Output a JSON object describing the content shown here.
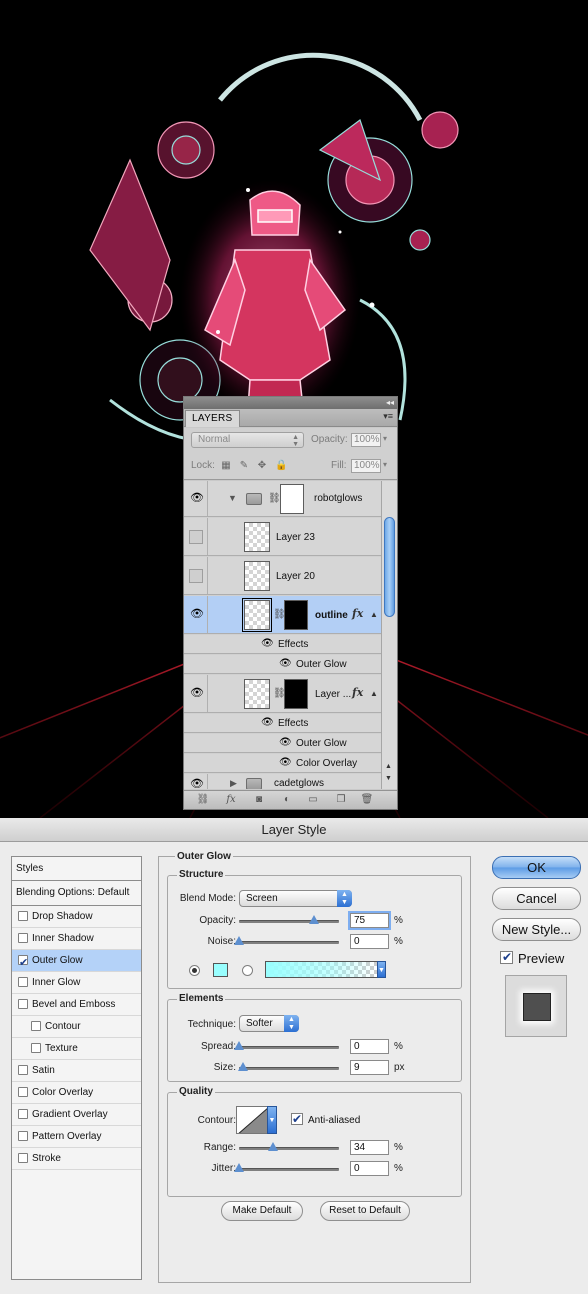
{
  "layers_panel": {
    "tab": "LAYERS",
    "blend_mode": "Normal",
    "opacity_label": "Opacity:",
    "opacity_value": "100%",
    "lock_label": "Lock:",
    "fill_label": "Fill:",
    "fill_value": "100%",
    "layers": [
      {
        "name": "robotglows",
        "type": "group-expanded",
        "visible": true
      },
      {
        "name": "Layer 23",
        "type": "layer",
        "visible": false
      },
      {
        "name": "Layer 20",
        "type": "layer",
        "visible": false
      },
      {
        "name": "outline",
        "type": "layer-with-mask",
        "visible": true,
        "selected": true,
        "effects_label": "Effects",
        "effects": [
          "Outer Glow"
        ]
      },
      {
        "name": "Layer ...",
        "type": "layer-with-mask",
        "visible": true,
        "effects_label": "Effects",
        "effects": [
          "Outer Glow",
          "Color Overlay"
        ]
      },
      {
        "name": "cadetglows",
        "type": "group-collapsed",
        "visible": true
      }
    ],
    "fx_label": "fx",
    "footer_icons": [
      "link-icon",
      "fx-icon",
      "add-mask-icon",
      "adjustment-icon",
      "new-group-icon",
      "new-layer-icon",
      "trash-icon"
    ]
  },
  "dialog": {
    "title": "Layer Style",
    "styles_header": "Styles",
    "blending_options": "Blending Options: Default",
    "styles": [
      {
        "label": "Drop Shadow",
        "checked": false,
        "indent": false
      },
      {
        "label": "Inner Shadow",
        "checked": false,
        "indent": false
      },
      {
        "label": "Outer Glow",
        "checked": true,
        "indent": false,
        "selected": true
      },
      {
        "label": "Inner Glow",
        "checked": false,
        "indent": false
      },
      {
        "label": "Bevel and Emboss",
        "checked": false,
        "indent": false
      },
      {
        "label": "Contour",
        "checked": false,
        "indent": true
      },
      {
        "label": "Texture",
        "checked": false,
        "indent": true
      },
      {
        "label": "Satin",
        "checked": false,
        "indent": false
      },
      {
        "label": "Color Overlay",
        "checked": false,
        "indent": false
      },
      {
        "label": "Gradient Overlay",
        "checked": false,
        "indent": false
      },
      {
        "label": "Pattern Overlay",
        "checked": false,
        "indent": false
      },
      {
        "label": "Stroke",
        "checked": false,
        "indent": false
      }
    ],
    "outer_glow": {
      "title": "Outer Glow",
      "structure": {
        "title": "Structure",
        "blend_mode_label": "Blend Mode:",
        "blend_mode": "Screen",
        "opacity_label": "Opacity:",
        "opacity": "75",
        "opacity_fraction": 0.75,
        "noise_label": "Noise:",
        "noise": "0",
        "noise_fraction": 0,
        "percent": "%",
        "glow_color": "#99ffff"
      },
      "elements": {
        "title": "Elements",
        "technique_label": "Technique:",
        "technique": "Softer",
        "spread_label": "Spread:",
        "spread": "0",
        "spread_fraction": 0,
        "size_label": "Size:",
        "size": "9",
        "size_fraction": 0.04,
        "percent": "%",
        "px": "px"
      },
      "quality": {
        "title": "Quality",
        "contour_label": "Contour:",
        "anti_aliased_label": "Anti-aliased",
        "anti_aliased": true,
        "range_label": "Range:",
        "range": "34",
        "range_fraction": 0.34,
        "jitter_label": "Jitter:",
        "jitter": "0",
        "jitter_fraction": 0,
        "percent": "%"
      },
      "make_default": "Make Default",
      "reset_default": "Reset to Default"
    },
    "buttons": {
      "ok": "OK",
      "cancel": "Cancel",
      "new_style": "New Style...",
      "preview_label": "Preview"
    }
  }
}
